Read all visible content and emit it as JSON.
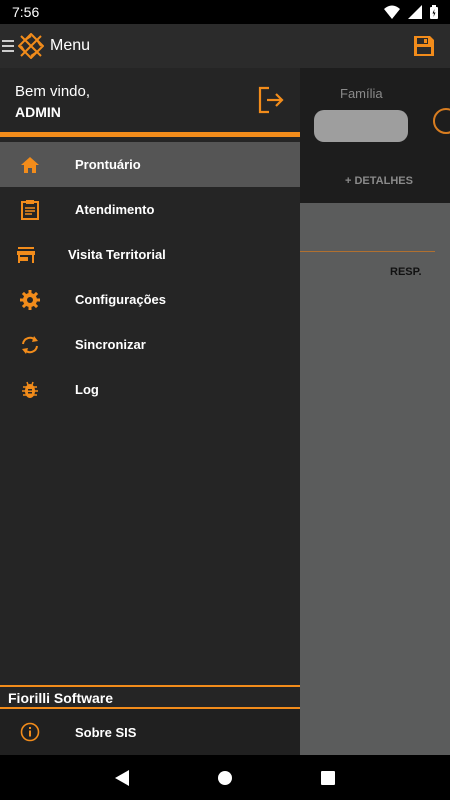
{
  "status_bar": {
    "time": "7:56"
  },
  "app_bar": {
    "title": "Menu"
  },
  "drawer": {
    "welcome": "Bem vindo,",
    "username": "ADMIN",
    "items": [
      {
        "label": "Prontuário",
        "icon": "home-icon",
        "active": true
      },
      {
        "label": "Atendimento",
        "icon": "clipboard-icon",
        "active": false
      },
      {
        "label": "Visita Territorial",
        "icon": "store-icon",
        "active": false
      },
      {
        "label": "Configurações",
        "icon": "gear-icon",
        "active": false
      },
      {
        "label": "Sincronizar",
        "icon": "sync-icon",
        "active": false
      },
      {
        "label": "Log",
        "icon": "bug-icon",
        "active": false
      }
    ],
    "footer": {
      "brand": "Fiorilli Software",
      "about_label": "Sobre SIS"
    }
  },
  "background": {
    "familia_label": "Família",
    "detalhes_label": "+ DETALHES",
    "resp_label": "RESP."
  },
  "colors": {
    "accent": "#f28c1b",
    "drawer_bg": "#252525",
    "active_item_bg": "#555555"
  }
}
